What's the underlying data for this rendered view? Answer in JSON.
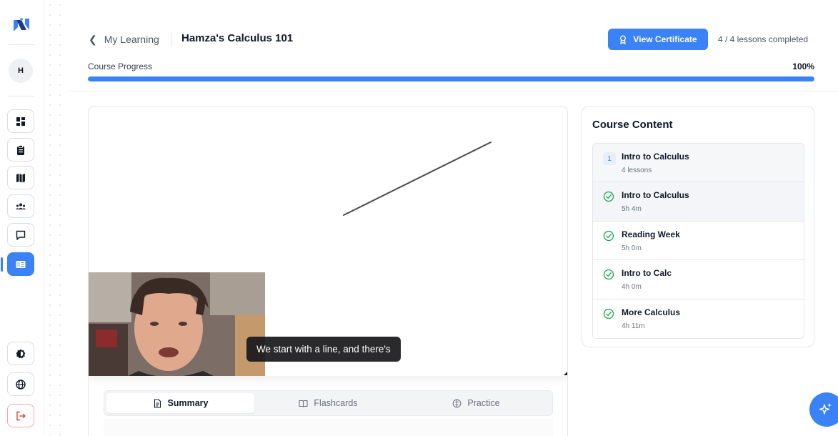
{
  "sidebar": {
    "avatar_initial": "H",
    "items": [
      {
        "name": "dashboard",
        "icon": "grid-icon"
      },
      {
        "name": "assignments",
        "icon": "clipboard-icon"
      },
      {
        "name": "map",
        "icon": "map-icon"
      },
      {
        "name": "community",
        "icon": "users-icon"
      },
      {
        "name": "messages",
        "icon": "chat-icon"
      },
      {
        "name": "courses",
        "icon": "book-open-icon",
        "active": true
      }
    ],
    "bottom": [
      {
        "name": "theme",
        "icon": "contrast-icon"
      },
      {
        "name": "language",
        "icon": "globe-icon"
      },
      {
        "name": "logout",
        "icon": "logout-icon"
      }
    ]
  },
  "header": {
    "back_label": "My Learning",
    "course_title": "Hamza's Calculus 101",
    "certificate_label": "View Certificate",
    "lessons_completed": "4 / 4 lessons completed",
    "progress_label": "Course Progress",
    "progress_pct_text": "100%",
    "progress_value": 1.0
  },
  "video": {
    "caption": "We start with a line, and there's"
  },
  "tabs": [
    {
      "label": "Summary",
      "icon": "document-icon",
      "active": true
    },
    {
      "label": "Flashcards",
      "icon": "book-icon",
      "active": false
    },
    {
      "label": "Practice",
      "icon": "brain-icon",
      "active": false
    }
  ],
  "course_content": {
    "title": "Course Content",
    "module": {
      "number": "1",
      "title": "Intro to Calculus",
      "subtitle": "4 lessons"
    },
    "lessons": [
      {
        "title": "Intro to Calculus",
        "duration": "5h 4m",
        "completed": true,
        "current": true
      },
      {
        "title": "Reading Week",
        "duration": "5h 0m",
        "completed": true,
        "current": false
      },
      {
        "title": "Intro to Calc",
        "duration": "4h 0m",
        "completed": true,
        "current": false
      },
      {
        "title": "More Calculus",
        "duration": "4h 11m",
        "completed": true,
        "current": false
      }
    ]
  },
  "colors": {
    "accent": "#3b82f6",
    "success": "#16a34a",
    "danger": "#ef4444"
  }
}
